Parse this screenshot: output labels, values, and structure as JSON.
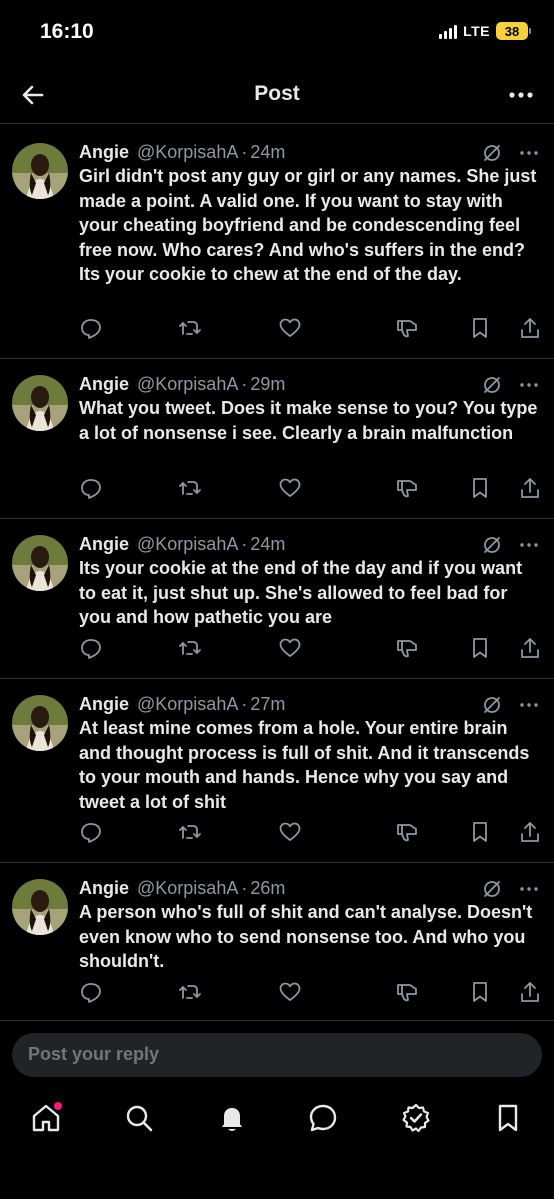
{
  "status_bar": {
    "time": "16:10",
    "network": "LTE",
    "battery": "38"
  },
  "header": {
    "title": "Post"
  },
  "posts": [
    {
      "name": "Angie",
      "handle": "@KorpisahA",
      "age": "24m",
      "text": "Girl didn't post any guy or girl or any names. She just made a point. A valid one. If you want to stay with your cheating boyfriend and be condescending feel free now. Who cares? And who's suffers in the end?\nIts your cookie to chew at the end of the day."
    },
    {
      "name": "Angie",
      "handle": "@KorpisahA",
      "age": "29m",
      "text": "What you tweet. Does it make sense to you? You type a lot of nonsense i see. Clearly a brain malfunction"
    },
    {
      "name": "Angie",
      "handle": "@KorpisahA",
      "age": "24m",
      "text": "Its your cookie at the end of the day and if you want to eat it, just shut up. She's allowed to feel bad for you and how pathetic you are"
    },
    {
      "name": "Angie",
      "handle": "@KorpisahA",
      "age": "27m",
      "text": "At least mine comes from a hole. Your entire brain and thought process is full of shit. And it transcends to your mouth and hands. Hence why you say and tweet a lot of shit"
    },
    {
      "name": "Angie",
      "handle": "@KorpisahA",
      "age": "26m",
      "text": "A person who's full of shit and can't analyse. Doesn't even know who to send nonsense too. And who you shouldn't."
    }
  ],
  "reply_box": {
    "placeholder": "Post your reply"
  },
  "bottom_nav": [
    "home-icon",
    "search-icon",
    "bell-icon",
    "messages-icon",
    "verified-icon",
    "bookmark-icon"
  ],
  "colors": {
    "background": "#000000",
    "text": "#e7e9ea",
    "muted": "#8b98a5",
    "divider": "#2f3336",
    "battery": "#f5d13b",
    "badge": "#f91880"
  }
}
